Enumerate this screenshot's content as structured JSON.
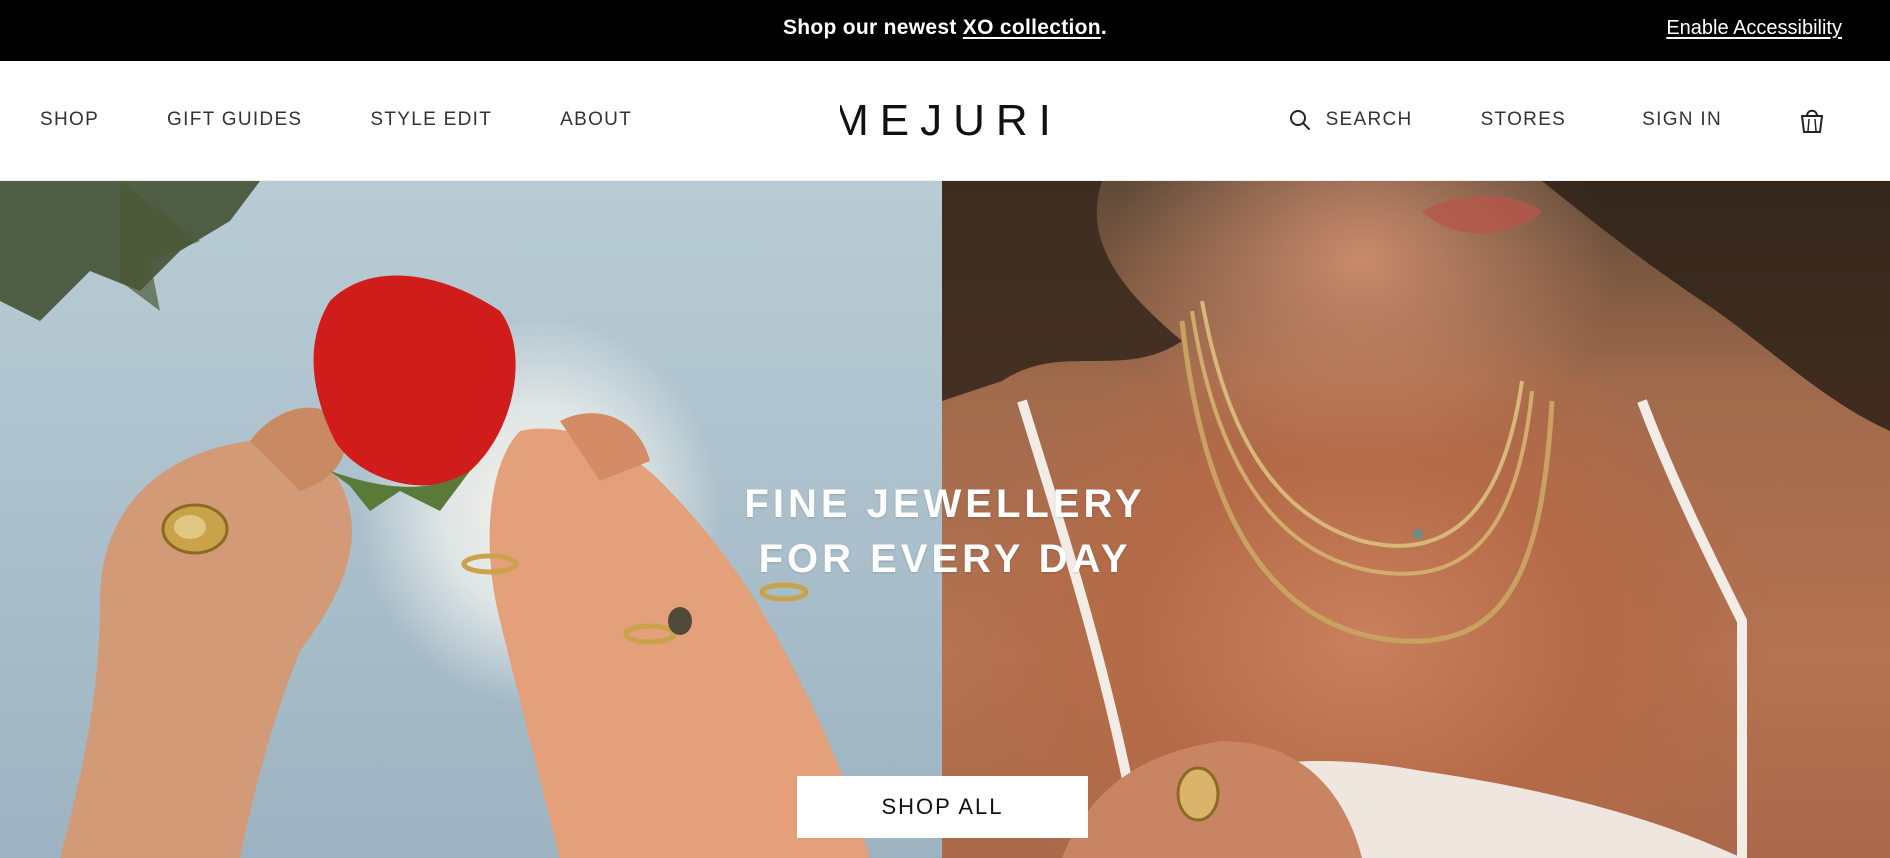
{
  "announcement": {
    "prefix": "Shop our newest ",
    "link": "XO collection",
    "suffix": ".",
    "accessibility": "Enable Accessibility"
  },
  "nav": {
    "left": [
      "SHOP",
      "GIFT GUIDES",
      "STYLE EDIT",
      "ABOUT"
    ],
    "logo": "MEJURI",
    "search": "SEARCH",
    "stores": "STORES",
    "sign_in": "SIGN IN"
  },
  "hero": {
    "title_line1": "FINE JEWELLERY",
    "title_line2": "FOR EVERY DAY",
    "cta": "SHOP ALL"
  },
  "icons": {
    "search": "search-icon",
    "bag": "shopping-bag-icon"
  },
  "colors": {
    "announcement_bg": "#000000",
    "text_dark": "#333333",
    "cta_bg": "#ffffff"
  }
}
